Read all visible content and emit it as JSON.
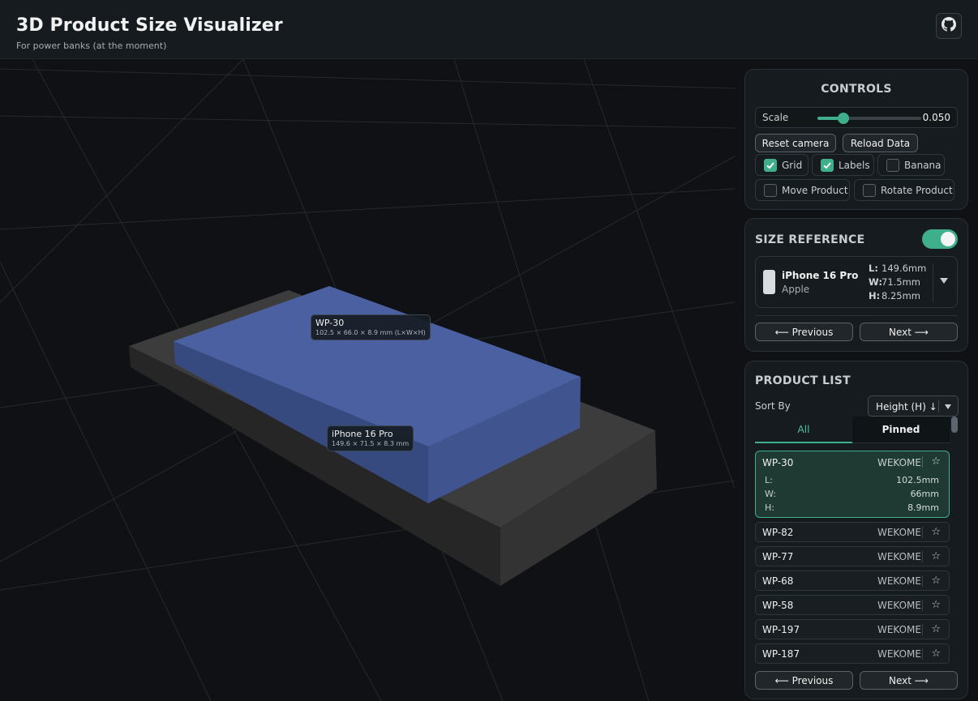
{
  "header": {
    "title": "3D Product Size Visualizer",
    "subtitle": "For power banks (at the moment)",
    "github_icon": "github-icon"
  },
  "viewport": {
    "product_label": {
      "name": "WP-30",
      "dims": "102.5 × 66.0 × 8.9 mm (L×W×H)"
    },
    "reference_label": {
      "name": "iPhone 16 Pro",
      "dims": "149.6 × 71.5 × 8.3 mm"
    },
    "colors": {
      "product": "#4a60a0",
      "reference": "#3c3c3c",
      "grid": "#252a30"
    }
  },
  "controls": {
    "title": "CONTROLS",
    "scale_label": "Scale",
    "scale_value": "0.050",
    "scale_fraction": 0.25,
    "reset_camera": "Reset camera",
    "reload_data": "Reload Data",
    "checkboxes": [
      {
        "label": "Grid",
        "checked": true
      },
      {
        "label": "Labels",
        "checked": true
      },
      {
        "label": "Banana",
        "checked": false
      },
      {
        "label": "Move Product",
        "checked": false
      },
      {
        "label": "Rotate Product",
        "checked": false
      }
    ]
  },
  "size_reference": {
    "title": "SIZE REFERENCE",
    "enabled": true,
    "name": "iPhone 16 Pro",
    "brand": "Apple",
    "dims": [
      {
        "key": "L:",
        "value": "149.6mm"
      },
      {
        "key": "W:",
        "value": "71.5mm"
      },
      {
        "key": "H:",
        "value": "8.25mm"
      }
    ],
    "previous": "⟵ Previous",
    "next": "Next ⟶"
  },
  "product_list": {
    "title": "PRODUCT LIST",
    "sort_label": "Sort By",
    "sort_value": "Height (H) ↓",
    "tabs": [
      "All",
      "Pinned"
    ],
    "selected": {
      "name": "WP-30",
      "brand": "WEKOME",
      "dims": [
        {
          "key": "L:",
          "value": "102.5mm"
        },
        {
          "key": "W:",
          "value": "66mm"
        },
        {
          "key": "H:",
          "value": "8.9mm"
        }
      ]
    },
    "items": [
      {
        "name": "WP-82",
        "brand": "WEKOME"
      },
      {
        "name": "WP-77",
        "brand": "WEKOME"
      },
      {
        "name": "WP-68",
        "brand": "WEKOME"
      },
      {
        "name": "WP-58",
        "brand": "WEKOME"
      },
      {
        "name": "WP-197",
        "brand": "WEKOME"
      },
      {
        "name": "WP-187",
        "brand": "WEKOME"
      }
    ],
    "star_icon": "☆",
    "previous": "⟵ Previous",
    "next": "Next ⟶"
  },
  "accent": "#3fae8a"
}
